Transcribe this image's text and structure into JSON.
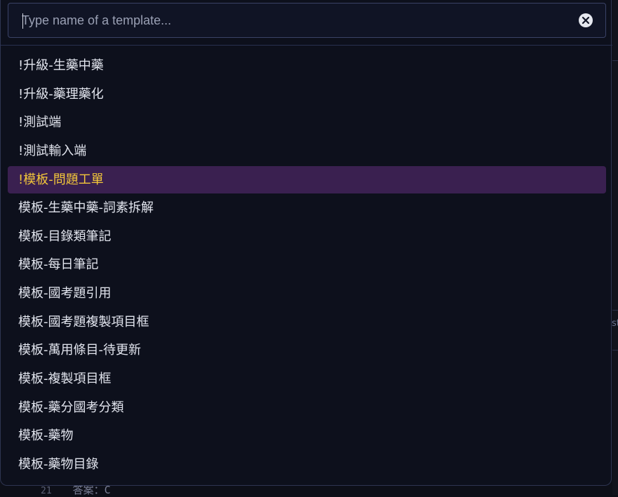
{
  "search": {
    "placeholder": "Type name of a template...",
    "value": ""
  },
  "icons": {
    "clear": "close-circle-icon"
  },
  "colors": {
    "background": "#0d101c",
    "border": "#2e3552",
    "selected_background": "#3a2050",
    "selected_text": "#f2c63a",
    "text": "#e2e5ee"
  },
  "templates": [
    {
      "label": "!升級-生藥中藥",
      "selected": false
    },
    {
      "label": "!升級-藥理藥化",
      "selected": false
    },
    {
      "label": "!測試端",
      "selected": false
    },
    {
      "label": "!測試輸入端",
      "selected": false
    },
    {
      "label": "!模板-問題工單",
      "selected": true
    },
    {
      "label": "模板-生藥中藥-詞素拆解",
      "selected": false
    },
    {
      "label": "模板-目錄類筆記",
      "selected": false
    },
    {
      "label": "模板-每日筆記",
      "selected": false
    },
    {
      "label": "模板-國考題引用",
      "selected": false
    },
    {
      "label": "模板-國考題複製項目框",
      "selected": false
    },
    {
      "label": "模板-萬用條目-待更新",
      "selected": false
    },
    {
      "label": "模板-複製項目框",
      "selected": false
    },
    {
      "label": "模板-藥分國考分類",
      "selected": false
    },
    {
      "label": "模板-藥物",
      "selected": false
    },
    {
      "label": "模板-藥物目錄",
      "selected": false
    }
  ],
  "background_editor": {
    "line_number": "21",
    "line_text": "答案：C",
    "right_fragment": "st"
  }
}
